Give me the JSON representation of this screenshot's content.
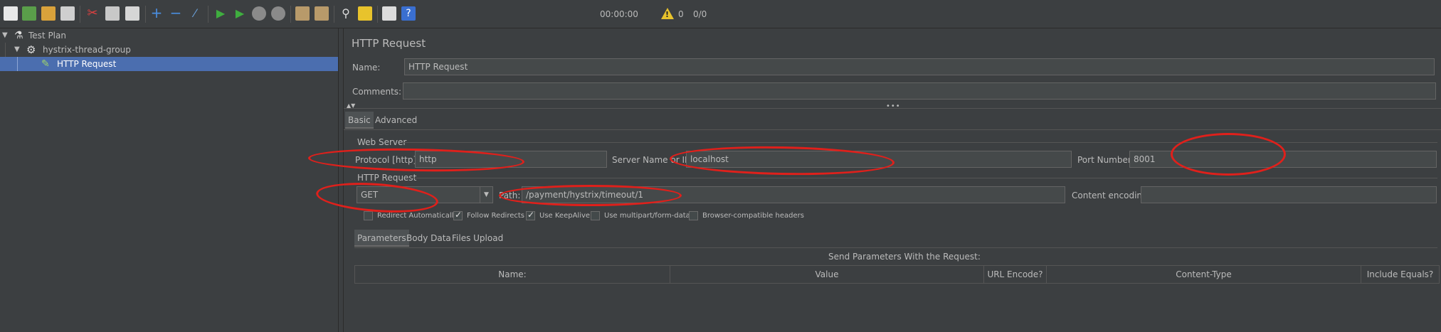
{
  "toolbar": {
    "timer": "00:00:00",
    "warnings": "0",
    "threads": "0/0",
    "icons": [
      "new-icon",
      "templates-icon",
      "open-icon",
      "save-icon",
      "cut-icon",
      "copy-icon",
      "paste-icon",
      "expand-icon",
      "collapse-icon",
      "toggle-icon",
      "start-icon",
      "start-no-pause-icon",
      "stop-icon",
      "shutdown-icon",
      "clear-icon",
      "clear-all-icon",
      "search-icon",
      "reset-search-icon",
      "function-helper-icon",
      "help-icon"
    ]
  },
  "tree": {
    "items": [
      {
        "label": "Test Plan",
        "icon": "flask-icon"
      },
      {
        "label": "hystrix-thread-group",
        "icon": "gear-icon"
      },
      {
        "label": "HTTP Request",
        "icon": "pipette-icon"
      }
    ]
  },
  "panel": {
    "title": "HTTP Request",
    "name_label": "Name:",
    "name_value": "HTTP Request",
    "comments_label": "Comments:",
    "comments_value": "",
    "tabs": [
      "Basic",
      "Advanced"
    ],
    "web_server_section": "Web Server",
    "protocol_label": "Protocol [http]:",
    "protocol_value": "http",
    "server_label": "Server Name or IP:",
    "server_value": "localhost",
    "port_label": "Port Number:",
    "port_value": "8001",
    "http_request_section": "HTTP Request",
    "method_value": "GET",
    "path_label": "Path:",
    "path_value": "/payment/hystrix/timeout/1",
    "encoding_label": "Content encoding:",
    "encoding_value": "",
    "checkboxes": [
      {
        "label": "Redirect Automatically",
        "checked": false
      },
      {
        "label": "Follow Redirects",
        "checked": true
      },
      {
        "label": "Use KeepAlive",
        "checked": true
      },
      {
        "label": "Use multipart/form-data",
        "checked": false
      },
      {
        "label": "Browser-compatible headers",
        "checked": false
      }
    ],
    "sub_tabs": [
      "Parameters",
      "Body Data",
      "Files Upload"
    ],
    "params_caption": "Send Parameters With the Request:",
    "columns": [
      "Name:",
      "Value",
      "URL Encode?",
      "Content-Type",
      "Include Equals?"
    ]
  }
}
